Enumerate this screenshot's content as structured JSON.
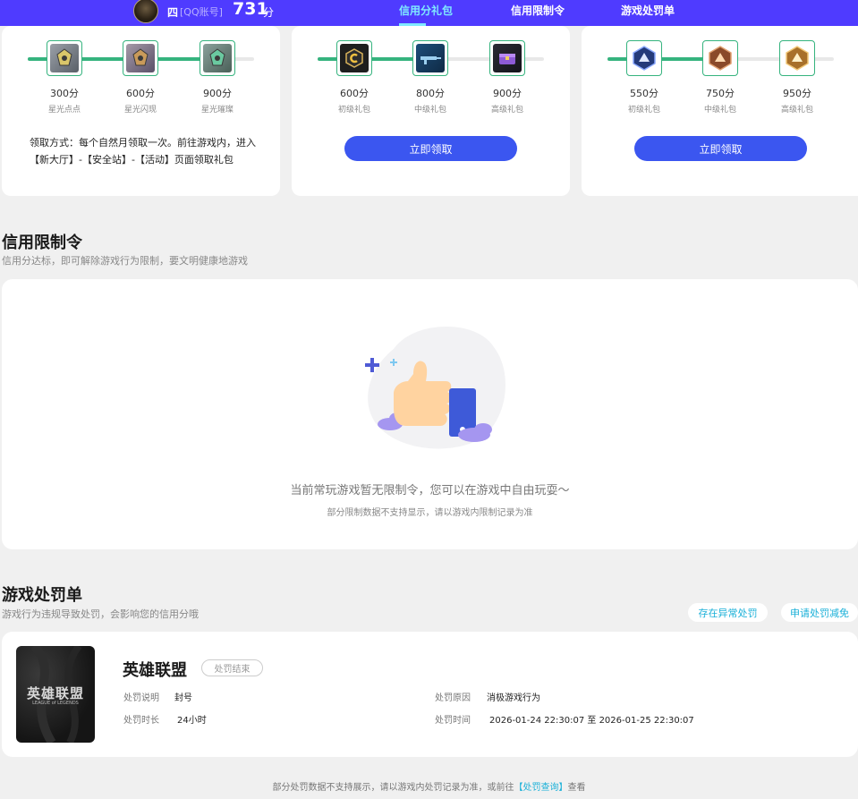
{
  "header": {
    "user_name": "四",
    "account_type": "[QQ账号]",
    "score": "731",
    "score_unit": "分",
    "tabs": [
      {
        "label": "信用分礼包",
        "active": true
      },
      {
        "label": "信用限制令",
        "active": false
      },
      {
        "label": "游戏处罚单",
        "active": false
      }
    ]
  },
  "reward_cards": [
    {
      "items": [
        {
          "points": "300分",
          "name": "星光点点",
          "icon": "star-mech-icon"
        },
        {
          "points": "600分",
          "name": "星光闪现",
          "icon": "star-mech-icon"
        },
        {
          "points": "900分",
          "name": "星光璀璨",
          "icon": "star-mech-icon"
        }
      ],
      "progress": 0.8,
      "note": "领取方式：每个自然月领取一次。前往游戏内，进入【新大厅】-【安全站】-【活动】页面领取礼包"
    },
    {
      "items": [
        {
          "points": "600分",
          "name": "初级礼包",
          "icon": "c-badge-icon"
        },
        {
          "points": "800分",
          "name": "中级礼包",
          "icon": "rifle-icon"
        },
        {
          "points": "900分",
          "name": "高级礼包",
          "icon": "crate-icon"
        }
      ],
      "progress": 0.45,
      "button": "立即领取"
    },
    {
      "items": [
        {
          "points": "550分",
          "name": "初级礼包",
          "icon": "blue-emblem-icon"
        },
        {
          "points": "750分",
          "name": "中级礼包",
          "icon": "bronze-emblem-icon"
        },
        {
          "points": "950分",
          "name": "高级礼包",
          "icon": "gold-emblem-icon"
        }
      ],
      "progress": 0.45,
      "button": "立即领取"
    }
  ],
  "limit_section": {
    "title": "信用限制令",
    "subtitle": "信用分达标，即可解除游戏行为限制，要文明健康地游戏",
    "empty_message": "当前常玩游戏暂无限制令，您可以在游戏中自由玩耍～",
    "empty_note": "部分限制数据不支持显示，请以游戏内限制记录为准"
  },
  "penalty_section": {
    "title": "游戏处罚单",
    "subtitle": "游戏行为违规导致处罚，会影响您的信用分哦",
    "actions": [
      "存在异常处罚",
      "申请处罚减免"
    ],
    "record": {
      "game": "英雄联盟",
      "logo_text": "英雄联盟",
      "logo_sub": "LEAGUE of LEGENDS",
      "status": "处罚结束",
      "desc_label": "处罚说明",
      "desc_value": "封号",
      "reason_label": "处罚原因",
      "reason_value": "消极游戏行为",
      "duration_label": "处罚时长",
      "duration_value": "24小时",
      "time_label": "处罚时间",
      "time_value": "2026-01-24 22:30:07 至 2026-01-25 22:30:07"
    }
  },
  "footer": {
    "before": "部分处罚数据不支持展示，请以游戏内处罚记录为准，或前往",
    "link": "【处罚查询】",
    "after": "查看"
  },
  "colors": {
    "header_bg": "#4f3bff",
    "accent_blue": "#3b56f0",
    "progress_green": "#35b37e",
    "link_cyan": "#1ab0d8"
  }
}
